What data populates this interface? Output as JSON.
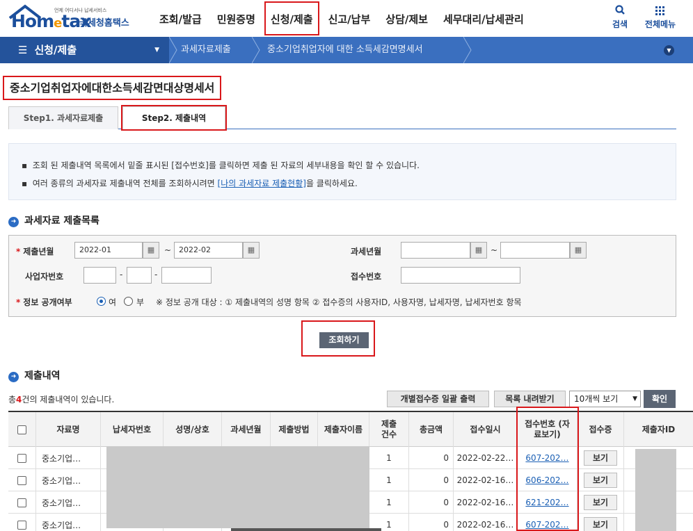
{
  "header": {
    "logo_main_a": "Hom",
    "logo_main_e": "e",
    "logo_main_b": "tax",
    "logo_sub": "언제 어디서나 납세서비스",
    "logo_agency": "국세청홈택스",
    "nav": [
      "조회/발급",
      "민원증명",
      "신청/제출",
      "신고/납부",
      "상담/제보",
      "세무대리/납세관리"
    ],
    "active_nav": "신청/제출",
    "search_label": "검색",
    "menu_label": "전체메뉴"
  },
  "subnav": {
    "menu": "신청/제출",
    "crumb1": "과세자료제출",
    "crumb2": "중소기업취업자에 대한 소득세감면명세서"
  },
  "page_title": "중소기업취업자에대한소득세감면대상명세서",
  "tabs": [
    "Step1. 과세자료제출",
    "Step2. 제출내역"
  ],
  "info": {
    "line1": "조회 된 제출내역 목록에서 밑줄 표시된 [접수번호]를 클릭하면 제출 된 자료의 세부내용을 확인 할 수 있습니다.",
    "line2_pre": "여러 종류의 과세자료 제출내역 전체를 조회하시려면 ",
    "line2_link": "[나의 과세자료 제출현황]",
    "line2_post": "을 클릭하세요."
  },
  "section1_title": "과세자료 제출목록",
  "form": {
    "submit_ym_label": "제출년월",
    "submit_from": "2022-01",
    "submit_to": "2022-02",
    "tax_ym_label": "과세년월",
    "tax_from": "",
    "tax_to": "",
    "biz_no_label": "사업자번호",
    "receipt_no_label": "접수번호",
    "disclosure_label": "정보 공개여부",
    "yes": "여",
    "no": "부",
    "selected": "여",
    "note": "※ 정보 공개 대상 : ① 제출내역의 성명 항목 ② 접수증의 사용자ID, 사용자명, 납세자명, 납세자번호 항목",
    "tilde": "~",
    "dash": "-"
  },
  "search_button": "조회하기",
  "section2_title": "제출내역",
  "results": {
    "total_pre": "총",
    "total_count": "4",
    "total_post": "건의 제출내역이 있습니다.",
    "btn_print": "개별접수증 일괄 출력",
    "btn_download": "목록 내려받기",
    "page_size": "10개씩 보기",
    "btn_ok": "확인"
  },
  "table": {
    "columns": [
      "자료명",
      "납세자번호",
      "성명/상호",
      "과세년월",
      "제출방법",
      "제출자이름",
      "제출 건수",
      "총금액",
      "접수일시",
      "접수번호 (자료보기)",
      "접수증",
      "제출자ID"
    ],
    "rows": [
      {
        "name": "중소기업…",
        "count": "1",
        "amount": "0",
        "date": "2022-02-22…",
        "receipt": "607-202…",
        "view": "보기"
      },
      {
        "name": "중소기업…",
        "count": "1",
        "amount": "0",
        "date": "2022-02-16…",
        "receipt": "606-202…",
        "view": "보기"
      },
      {
        "name": "중소기업…",
        "count": "1",
        "amount": "0",
        "date": "2022-02-16…",
        "receipt": "621-202…",
        "view": "보기"
      },
      {
        "name": "중소기업…",
        "count": "1",
        "amount": "0",
        "date": "2022-02-16…",
        "receipt": "607-202…",
        "view": "보기"
      }
    ]
  },
  "colors": {
    "brand": "#1c4f9c",
    "subnav": "#3a6fbf",
    "highlight": "#d9171a"
  }
}
